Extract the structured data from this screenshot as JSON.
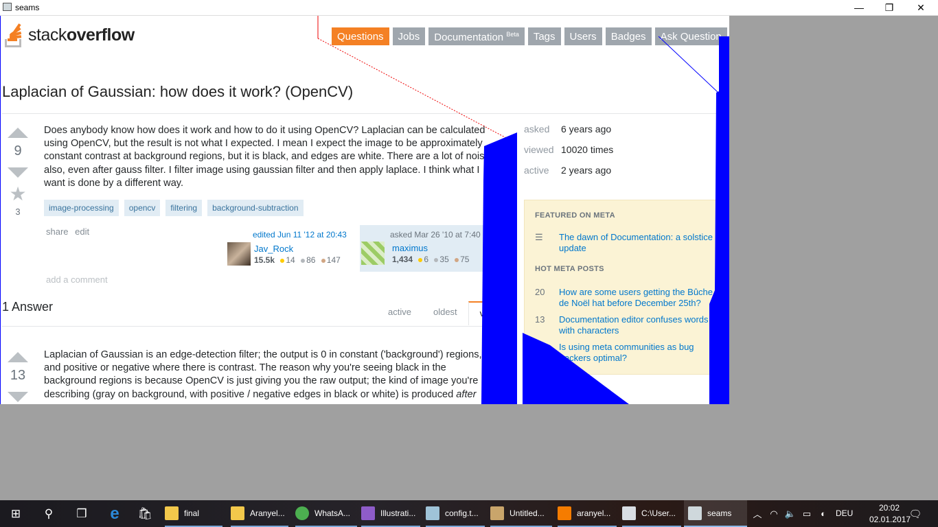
{
  "window": {
    "title": "seams",
    "minimize": "—",
    "restore": "❐",
    "close": "✕"
  },
  "logo": {
    "word_light": "stack",
    "word_bold": "overflow"
  },
  "nav": [
    {
      "label": "Questions",
      "active": true
    },
    {
      "label": "Jobs"
    },
    {
      "label": "Documentation",
      "badge": "Beta"
    },
    {
      "label": "Tags"
    },
    {
      "label": "Users"
    },
    {
      "label": "Badges"
    },
    {
      "label": "Ask Question"
    }
  ],
  "question": {
    "title": "Laplacian of Gaussian: how does it work? (OpenCV)",
    "votes": "9",
    "favorites": "3",
    "body": "Does anybody know how does it work and how to do it using OpenCV? Laplacian can be calculated using OpenCV, but the result is not what I expected. I mean I expect the image to be approximately constant contrast at background regions, but it is black, and edges are white. There are a lot of noise also, even after gauss filter. I filter image using gaussian filter and then apply laplace. I think what I want is done by a different way.",
    "tags": [
      "image-processing",
      "opencv",
      "filtering",
      "background-subtraction"
    ],
    "menu": {
      "share": "share",
      "edit": "edit"
    },
    "editor": {
      "action": "edited Jun 11 '12 at 20:43",
      "name": "Jav_Rock",
      "rep": "15.5k",
      "gold": "14",
      "silver": "86",
      "bronze": "147"
    },
    "owner": {
      "action": "asked Mar 26 '10 at 7:40",
      "name": "maximus",
      "rep": "1,434",
      "gold": "6",
      "silver": "35",
      "bronze": "75"
    },
    "add_comment": "add a comment"
  },
  "answers": {
    "header": "1 Answer",
    "sort_tabs": [
      "active",
      "oldest",
      "vo"
    ],
    "first": {
      "votes": "13",
      "body_main": "Laplacian of Gaussian is an edge-detection filter; the output is 0 in constant ('background') regions, and positive or negative where there is contrast. The reason why you're seeing black in the background regions is because OpenCV is just giving you the raw output; the kind of image you're describing (gray on background, with positive / negative edges in black or white) is produced ",
      "body_italic": "after"
    }
  },
  "stats": [
    {
      "label": "asked",
      "value": "6 years ago"
    },
    {
      "label": "viewed",
      "value": "10020 times"
    },
    {
      "label": "active",
      "value": "2 years ago"
    }
  ],
  "meta": {
    "featured_head": "FEATURED ON META",
    "featured": "The dawn of Documentation: a solstice update",
    "hot_head": "HOT META POSTS",
    "hot": [
      {
        "num": "20",
        "title": "How are some users getting the Bûche de Noël hat before December 25th?"
      },
      {
        "num": "13",
        "title": "Documentation editor confuses words with characters"
      },
      {
        "num": "",
        "title": "Is using meta communities as bug trackers optimal?"
      }
    ]
  },
  "taskbar": {
    "apps": [
      {
        "label": "final",
        "color": "#f2c84b"
      },
      {
        "label": "Aranyel...",
        "color": "#f2c84b"
      },
      {
        "label": "WhatsA...",
        "color": "#4caf50"
      },
      {
        "label": "Illustrati...",
        "color": "#8e5cc9"
      },
      {
        "label": "config.t...",
        "color": "#9fc3d8"
      },
      {
        "label": "Untitled...",
        "color": "#c9a56b"
      },
      {
        "label": "aranyel...",
        "color": "#f57c00"
      },
      {
        "label": "C:\\User...",
        "color": "#d8dde3"
      },
      {
        "label": "seams",
        "color": "#cfd8dc"
      }
    ],
    "lang": "DEU",
    "time": "20:02",
    "date": "02.01.2017"
  }
}
